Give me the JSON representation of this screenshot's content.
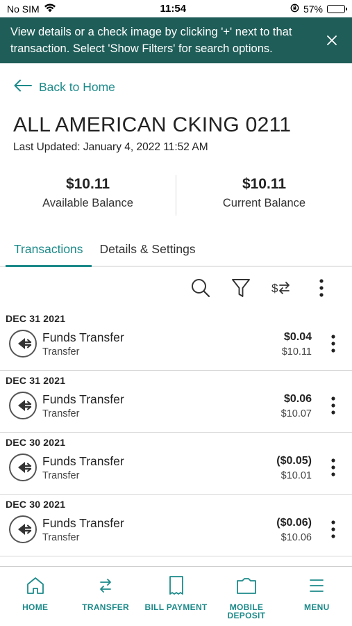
{
  "status_bar": {
    "carrier": "No SIM",
    "time": "11:54",
    "battery_percent": "57%",
    "battery_level": 0.57
  },
  "banner": {
    "message": "View details or a check image by clicking '+' next to that transaction. Select 'Show Filters' for search options.",
    "close_icon": "close-icon"
  },
  "back_link": {
    "label": "Back to Home"
  },
  "account": {
    "title": "ALL AMERICAN CKING 0211",
    "last_updated": "Last Updated: January 4, 2022 11:52 AM"
  },
  "balances": [
    {
      "amount": "$10.11",
      "label": "Available Balance"
    },
    {
      "amount": "$10.11",
      "label": "Current Balance"
    }
  ],
  "tabs": [
    {
      "label": "Transactions",
      "active": true
    },
    {
      "label": "Details & Settings",
      "active": false
    }
  ],
  "toolbar": {
    "icons": [
      "search-icon",
      "filter-icon",
      "money-transfer-icon",
      "more-vertical-icon"
    ]
  },
  "transactions": [
    {
      "date": "DEC 31 2021",
      "description": "Funds Transfer",
      "category": "Transfer",
      "amount": "$0.04",
      "balance": "$10.11"
    },
    {
      "date": "DEC 31 2021",
      "description": "Funds Transfer",
      "category": "Transfer",
      "amount": "$0.06",
      "balance": "$10.07"
    },
    {
      "date": "DEC 30 2021",
      "description": "Funds Transfer",
      "category": "Transfer",
      "amount": "($0.05)",
      "balance": "$10.01"
    },
    {
      "date": "DEC 30 2021",
      "description": "Funds Transfer",
      "category": "Transfer",
      "amount": "($0.06)",
      "balance": "$10.06"
    }
  ],
  "bottom_nav": [
    {
      "label": "HOME",
      "icon": "home-icon"
    },
    {
      "label": "TRANSFER",
      "icon": "transfer-arrows-icon"
    },
    {
      "label": "BILL PAYMENT",
      "icon": "receipt-icon"
    },
    {
      "label": "MOBILE DEPOSIT",
      "icon": "folder-icon"
    },
    {
      "label": "MENU",
      "icon": "hamburger-menu-icon"
    }
  ],
  "colors": {
    "banner_bg": "#1f5d58",
    "accent": "#1d8a8a",
    "text": "#222222"
  }
}
